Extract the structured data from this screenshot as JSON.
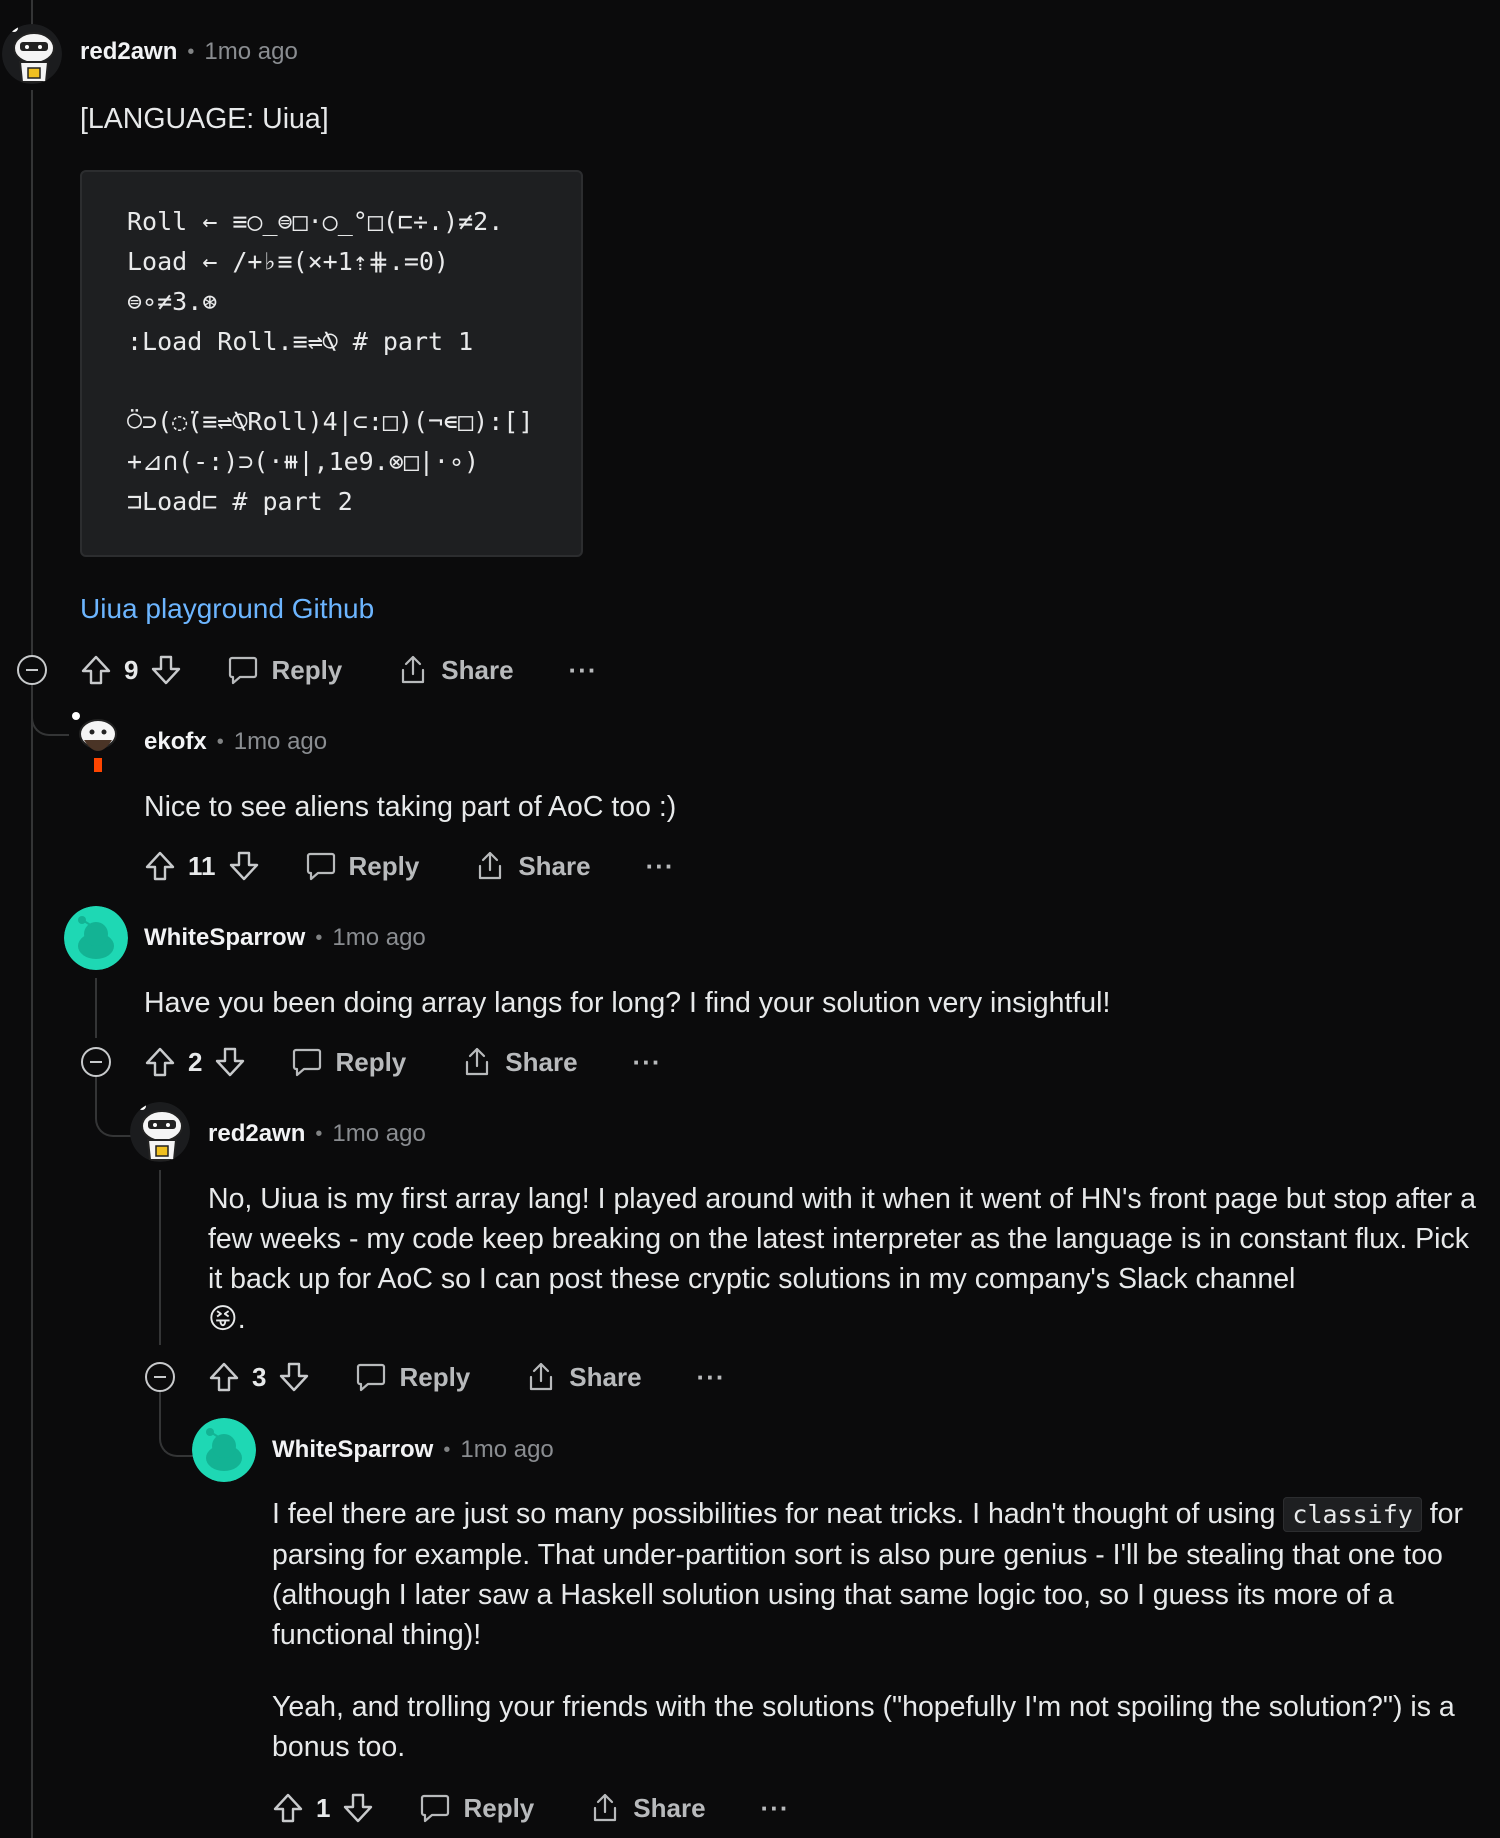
{
  "comments": [
    {
      "author": "red2awn",
      "age": "1mo ago",
      "lang_label": "[LANGUAGE: Uiua]",
      "code": [
        "Roll ← ≡○̲⊜□·○̲°□(⊏÷.)≠2.",
        "Load ← /+♭≡(×+1⇡⋕.=0)",
        "⊜∘≠3.⊛",
        ":Load Roll.≡⇌⍉ # part 1",
        "",
        "⍥⊃(◌̈(≡⇌⍉Roll)4|⊂:□)(¬∊□):[]",
        "+⊿∩(-:)⊃(·⧻|,1e9.⊗□|·∘)",
        "⊐Load⊏ # part 2"
      ],
      "link_text": "Uiua playground Github",
      "votes": "9",
      "reply": "Reply",
      "share": "Share",
      "more": "···"
    },
    {
      "author": "ekofx",
      "age": "1mo ago",
      "text": "Nice to see aliens taking part of AoC too :)",
      "votes": "11",
      "reply": "Reply",
      "share": "Share",
      "more": "···"
    },
    {
      "author": "WhiteSparrow",
      "age": "1mo ago",
      "text": "Have you been doing array langs for long? I find your solution very insightful!",
      "votes": "2",
      "reply": "Reply",
      "share": "Share",
      "more": "···"
    },
    {
      "author": "red2awn",
      "age": "1mo ago",
      "text": "No, Uiua is my first array lang! I played around with it when it went of HN's front page but stop after a few weeks - my code keep breaking on the latest interpreter as the language is in constant flux. Pick it back up for AoC so I can post these cryptic solutions in my company's Slack channel",
      "emoji": "😝",
      "text_end": ".",
      "votes": "3",
      "reply": "Reply",
      "share": "Share",
      "more": "···"
    },
    {
      "author": "WhiteSparrow",
      "age": "1mo ago",
      "text_a": "I feel there are just so many possibilities for neat tricks. I hadn't thought of using",
      "code_word": "classify",
      "text_b": "for parsing for example. That under-partition sort is also pure genius - I'll be stealing that one too (although I later saw a Haskell solution using that same logic too, so I guess its more of a functional thing)!",
      "text_c": "Yeah, and trolling your friends with the solutions (\"hopefully I'm not spoiling the solution?\") is a bonus too.",
      "votes": "1",
      "reply": "Reply",
      "share": "Share",
      "more": "···"
    }
  ],
  "colors": {
    "background": "#0b0b0c",
    "link": "#6cb5ff",
    "avatar_teal": "#1ed8b4"
  },
  "icons": [
    "upvote-icon",
    "downvote-icon",
    "comment-icon",
    "share-icon",
    "collapse-icon"
  ]
}
